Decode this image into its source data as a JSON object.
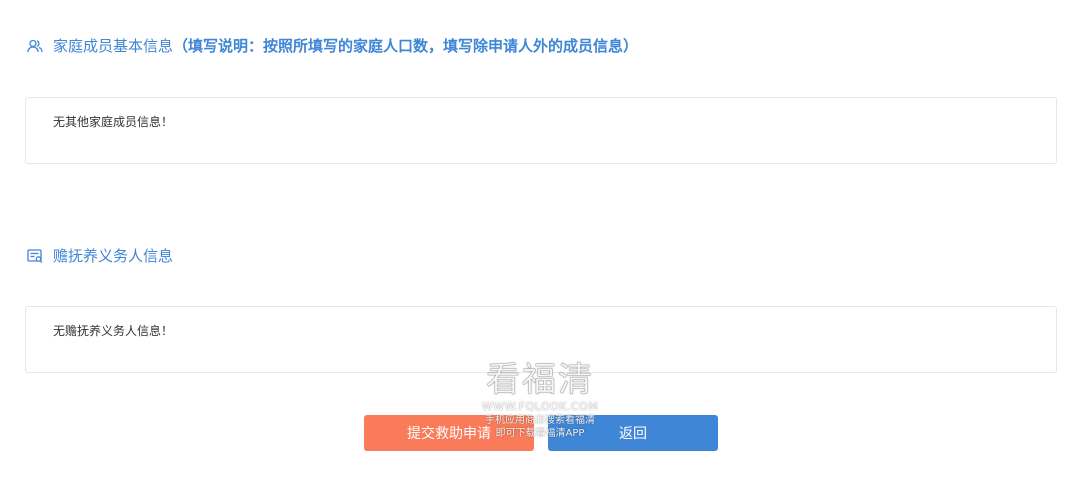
{
  "family_section": {
    "icon": "people-icon",
    "title": "家庭成员基本信息",
    "note": "（填写说明：按照所填写的家庭人口数，填写除申请人外的成员信息）",
    "empty_message": "无其他家庭成员信息！"
  },
  "support_section": {
    "icon": "contact-card-icon",
    "title": "赡抚养义务人信息",
    "empty_message": "无赡抚养义务人信息！"
  },
  "actions": {
    "submit_label": "提交救助申请",
    "back_label": "返回"
  },
  "watermark": {
    "logo": "看福清",
    "url": "WWW.FQLOOK.COM",
    "line1": "手机应用商店搜索看福清",
    "line2": "即可下载看福清APP"
  },
  "colors": {
    "accent": "#3f86d6",
    "submit": "#f97b5a",
    "border": "#e4e7ec",
    "text": "#333333"
  }
}
